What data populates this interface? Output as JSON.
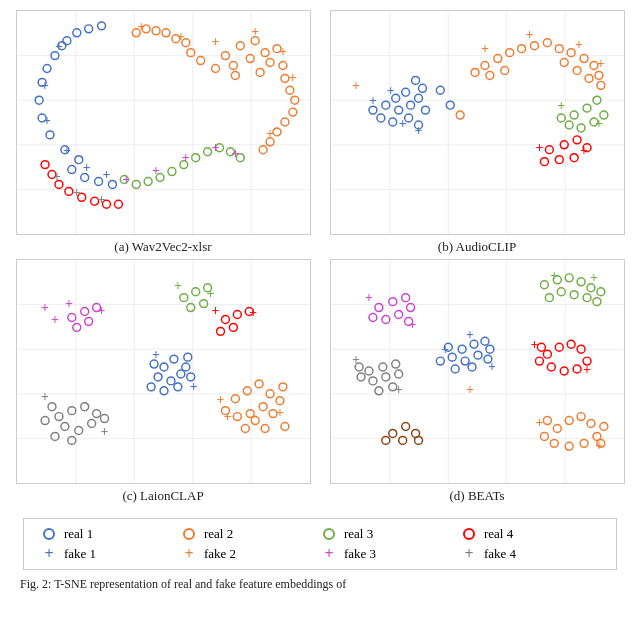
{
  "plots": [
    {
      "id": "plot-a",
      "caption": "(a) Wav2Vec2-xlsr",
      "label": "plot-wav2vec"
    },
    {
      "id": "plot-b",
      "caption": "(b) AudioCLIP",
      "label": "plot-audioclip"
    },
    {
      "id": "plot-c",
      "caption": "(c) LaionCLAP",
      "label": "plot-laionclap"
    },
    {
      "id": "plot-d",
      "caption": "(d) BEATs",
      "label": "plot-beats"
    }
  ],
  "legend": {
    "real_items": [
      {
        "label": "real 1",
        "color": "#4472C4"
      },
      {
        "label": "real 2",
        "color": "#ED7D31"
      },
      {
        "label": "real 3",
        "color": "#70AD47"
      },
      {
        "label": "real 4",
        "color": "#FF0000"
      }
    ],
    "fake_items": [
      {
        "label": "fake 1",
        "color": "#4472C4"
      },
      {
        "label": "fake 2",
        "color": "#ED7D31"
      },
      {
        "label": "fake 3",
        "color": "#CC44CC"
      },
      {
        "label": "fake 4",
        "color": "#808080"
      }
    ]
  },
  "fig_caption": "Fig. 2: T-SNE representation of real and fake feature embeddings of"
}
